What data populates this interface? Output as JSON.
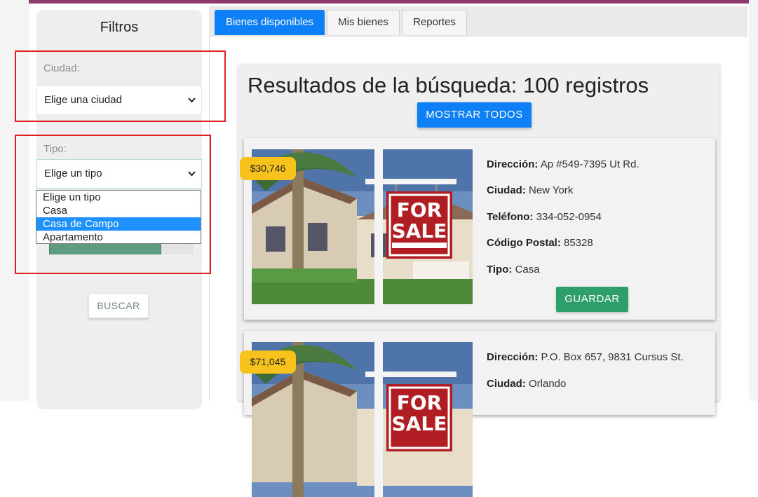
{
  "sidebar": {
    "title": "Filtros",
    "city": {
      "label": "Ciudad:",
      "value": "Elige una ciudad"
    },
    "type": {
      "label": "Tipo:",
      "value": "Elige un tipo",
      "options": [
        "Elige un tipo",
        "Casa",
        "Casa de Campo",
        "Apartamento"
      ],
      "highlighted": "Casa de Campo"
    },
    "search_label": "BUSCAR"
  },
  "tabs": [
    {
      "label": "Bienes disponibles",
      "active": true
    },
    {
      "label": "Mis bienes",
      "active": false
    },
    {
      "label": "Reportes",
      "active": false
    }
  ],
  "results": {
    "title": "Resultados de la búsqueda: 100 registros",
    "show_all_label": "MOSTRAR TODOS"
  },
  "listings": [
    {
      "price": "$30,746",
      "address_label": "Dirección:",
      "address": "Ap #549-7395 Ut Rd.",
      "city_label": "Ciudad:",
      "city": "New York",
      "phone_label": "Teléfono:",
      "phone": "334-052-0954",
      "zip_label": "Código Postal:",
      "zip": "85328",
      "type_label": "Tipo:",
      "type": "Casa",
      "save_label": "GUARDAR",
      "sign_text_1": "FOR",
      "sign_text_2": "SALE"
    },
    {
      "price": "$71,045",
      "address_label": "Dirección:",
      "address": "P.O. Box 657, 9831 Cursus St.",
      "city_label": "Ciudad:",
      "city": "Orlando",
      "sign_text_1": "FOR",
      "sign_text_2": "SALE"
    }
  ],
  "colors": {
    "primary": "#0d7ff7",
    "save": "#2e9e6b",
    "price_badge": "#f7c21b",
    "highlight_box": "#e02020",
    "top_bar": "#8c3a6e"
  }
}
